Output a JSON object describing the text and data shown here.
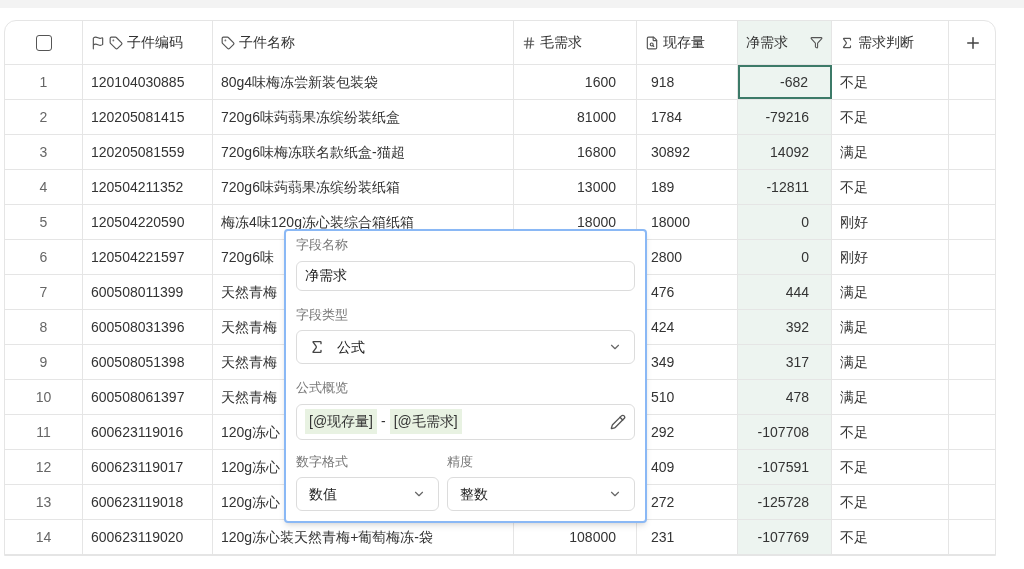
{
  "table": {
    "select_all_checked": false,
    "columns": [
      {
        "label": "子件编码",
        "kind": "primary",
        "selected": false
      },
      {
        "label": "子件名称",
        "kind": "link",
        "selected": false
      },
      {
        "label": "毛需求",
        "kind": "number",
        "selected": false
      },
      {
        "label": "现存量",
        "kind": "lookup",
        "selected": false
      },
      {
        "label": "净需求",
        "kind": "filter",
        "selected": true
      },
      {
        "label": "需求判断",
        "kind": "formula",
        "selected": false
      }
    ],
    "rows": [
      {
        "index": "1",
        "code": "120104030885",
        "name": "80g4味梅冻尝新装包装袋",
        "gross": "1600",
        "stock": "918",
        "net": "-682",
        "judgment": "不足",
        "net_focused": true
      },
      {
        "index": "2",
        "code": "120205081415",
        "name": "720g6味蒟蒻果冻缤纷装纸盒",
        "gross": "81000",
        "stock": "1784",
        "net": "-79216",
        "judgment": "不足",
        "net_focused": false
      },
      {
        "index": "3",
        "code": "120205081559",
        "name": "720g6味梅冻联名款纸盒-猫超",
        "gross": "16800",
        "stock": "30892",
        "net": "14092",
        "judgment": "满足",
        "net_focused": false
      },
      {
        "index": "4",
        "code": "120504211352",
        "name": "720g6味蒟蒻果冻缤纷装纸箱",
        "gross": "13000",
        "stock": "189",
        "net": "-12811",
        "judgment": "不足",
        "net_focused": false
      },
      {
        "index": "5",
        "code": "120504220590",
        "name": "梅冻4味120g冻心装综合箱纸箱",
        "gross": "18000",
        "stock": "18000",
        "net": "0",
        "judgment": "刚好",
        "net_focused": false
      },
      {
        "index": "6",
        "code": "120504221597",
        "name": "720g6味",
        "stock": "2800",
        "net": "0",
        "judgment": "刚好",
        "net_focused": false
      },
      {
        "index": "7",
        "code": "600508011399",
        "name": "天然青梅",
        "stock": "476",
        "net": "444",
        "judgment": "满足",
        "net_focused": false
      },
      {
        "index": "8",
        "code": "600508031396",
        "name": "天然青梅",
        "stock": "424",
        "net": "392",
        "judgment": "满足",
        "net_focused": false
      },
      {
        "index": "9",
        "code": "600508051398",
        "name": "天然青梅",
        "stock": "349",
        "net": "317",
        "judgment": "满足",
        "net_focused": false
      },
      {
        "index": "10",
        "code": "600508061397",
        "name": "天然青梅",
        "stock": "510",
        "net": "478",
        "judgment": "满足",
        "net_focused": false
      },
      {
        "index": "11",
        "code": "600623119016",
        "name": "120g冻心",
        "stock": "292",
        "net": "-107708",
        "judgment": "不足",
        "net_focused": false
      },
      {
        "index": "12",
        "code": "600623119017",
        "name": "120g冻心",
        "stock": "409",
        "net": "-107591",
        "judgment": "不足",
        "net_focused": false
      },
      {
        "index": "13",
        "code": "600623119018",
        "name": "120g冻心",
        "stock": "272",
        "net": "-125728",
        "judgment": "不足",
        "net_focused": false
      },
      {
        "index": "14",
        "code": "600623119020",
        "name": "120g冻心装天然青梅+葡萄梅冻-袋",
        "gross": "108000",
        "stock": "231",
        "net": "-107769",
        "judgment": "不足",
        "net_focused": false
      }
    ]
  },
  "field_popup": {
    "name_label": "字段名称",
    "name_value": "净需求",
    "type_label": "字段类型",
    "type_value": "公式",
    "formula_label": "公式概览",
    "formula": [
      {
        "text": "[@现存量]",
        "kind": "token"
      },
      {
        "text": "-",
        "kind": "operator"
      },
      {
        "text": "[@毛需求]",
        "kind": "token"
      }
    ],
    "format_label": "数字格式",
    "format_value": "数值",
    "precision_label": "精度",
    "precision_value": "整数"
  }
}
